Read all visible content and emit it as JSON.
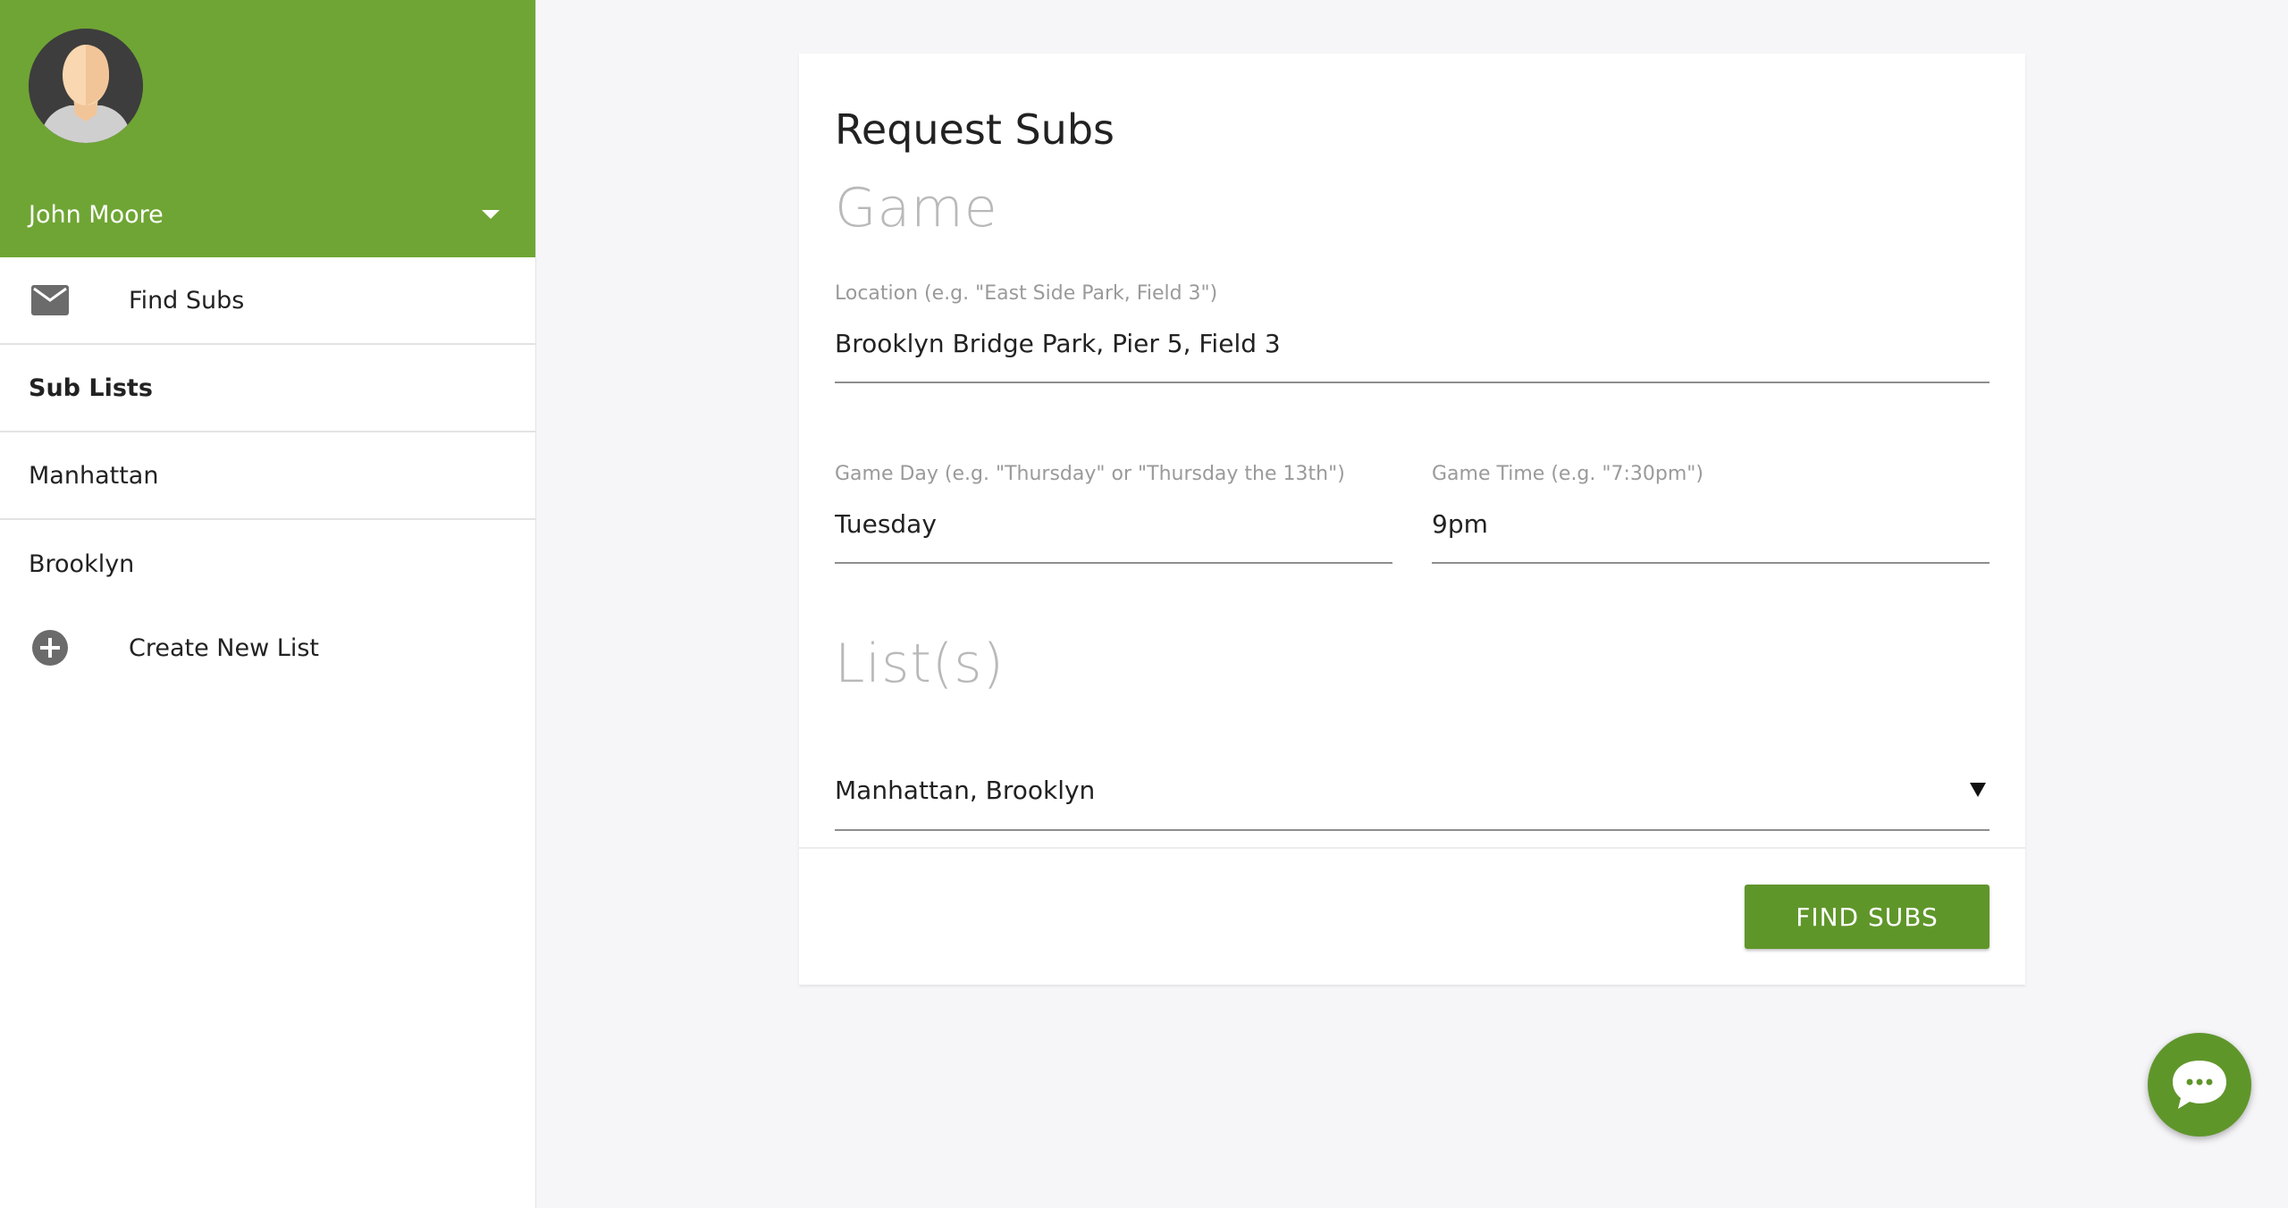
{
  "sidebar": {
    "user_name": "John Moore",
    "accent_color": "#6fa534",
    "items": [
      {
        "label": "Find Subs",
        "icon": "mail-icon"
      },
      {
        "label": "Sub Lists"
      },
      {
        "label": "Manhattan"
      },
      {
        "label": "Brooklyn"
      },
      {
        "label": "Create New List",
        "icon": "add-circle-icon"
      }
    ]
  },
  "main": {
    "title": "Request Subs",
    "game_section_heading": "Game",
    "location": {
      "label": "Location (e.g. \"East Side Park, Field 3\")",
      "value": "Brooklyn Bridge Park, Pier 5, Field 3"
    },
    "game_day": {
      "label": "Game Day (e.g. \"Thursday\" or \"Thursday the 13th\")",
      "value": "Tuesday"
    },
    "game_time": {
      "label": "Game Time (e.g. \"7:30pm\")",
      "value": "9pm"
    },
    "lists_section_heading": "List(s)",
    "lists_selected": "Manhattan, Brooklyn",
    "submit_label": "FIND SUBS",
    "button_color": "#5f962a"
  },
  "chat": {
    "icon": "chat-bubble-icon"
  }
}
